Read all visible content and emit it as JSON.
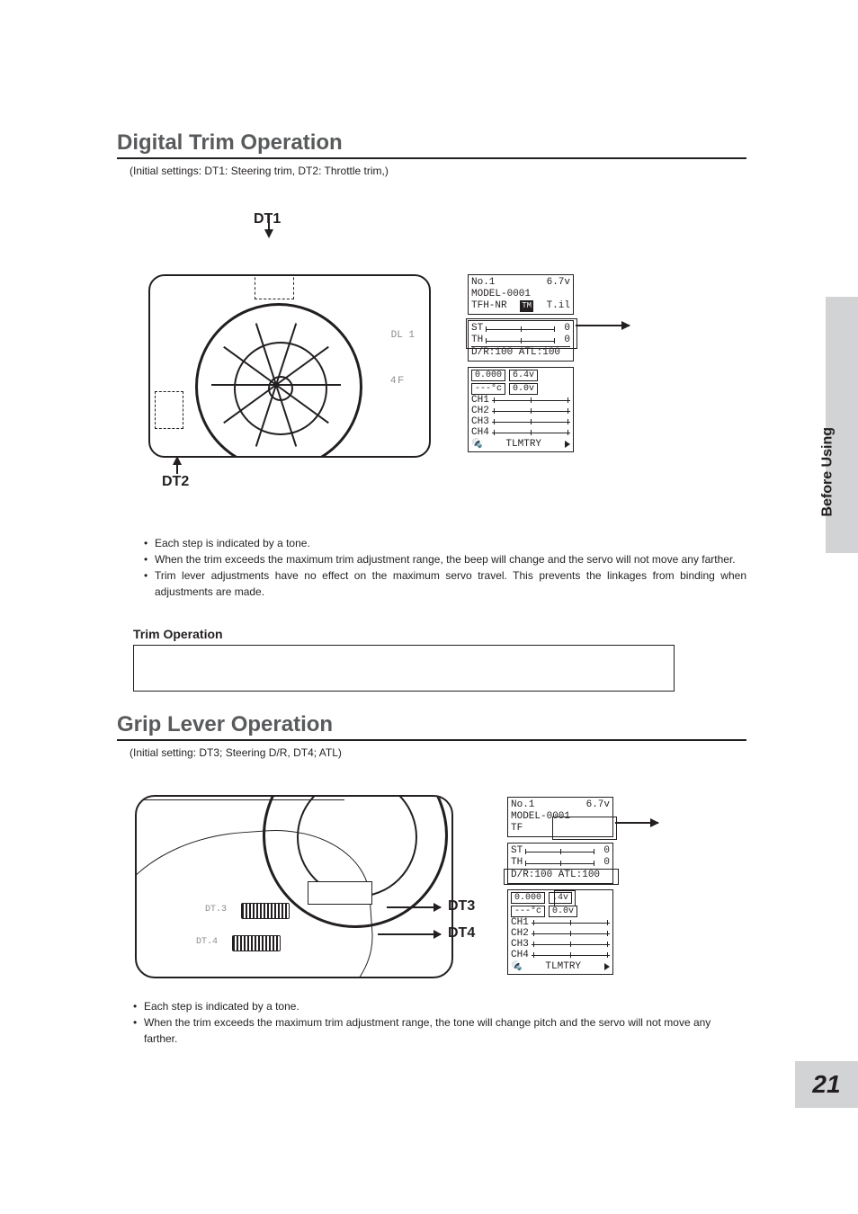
{
  "side_tab": "Before Using",
  "page_number": "21",
  "section1": {
    "title": "Digital Trim Operation",
    "initial": "(Initial settings: DT1: Steering trim, DT2: Throttle trim,)",
    "labels": {
      "dt1": "DT1",
      "dt2": "DT2",
      "dl1": "DL 1",
      "fourf": "4F"
    },
    "bullets": [
      "Each step is indicated by a tone.",
      "When the trim exceeds the maximum trim adjustment range, the beep will change and the servo will not move any farther.",
      "Trim lever adjustments have no effect on the maximum servo travel. This prevents the linkages from binding when adjustments are made."
    ],
    "sub_heading": "Trim Operation"
  },
  "section2": {
    "title": "Grip Lever Operation",
    "initial": "(Initial setting: DT3; Steering D/R,  DT4; ATL)",
    "labels": {
      "dt3": "DT3",
      "dt4": "DT4",
      "dl3": "DT.3",
      "dl4": "DT.4"
    },
    "bullets": [
      "Each step is indicated by a tone.",
      "When the trim exceeds the maximum trim adjustment range, the tone will change pitch and the servo will not move any farther."
    ]
  },
  "lcd": {
    "line1_left": "No.1",
    "line1_right": "6.7v",
    "line2": "MODEL-0001",
    "line3_a": "TFH-NR",
    "line3_b": "T.il",
    "st": "ST",
    "th": "TH",
    "st_val": "0",
    "th_val": "0",
    "dr_atl": "D/R:100 ATL:100",
    "timer": "0.000",
    "volt": "6.4v",
    "temp": "---°c",
    "volt2": "0.0v",
    "ch": [
      "CH1",
      "CH2",
      "CH3",
      "CH4"
    ],
    "tlm": "TLMTRY"
  },
  "lcd2": {
    "line3_a": "TF",
    "volt_hl": ".4v"
  }
}
